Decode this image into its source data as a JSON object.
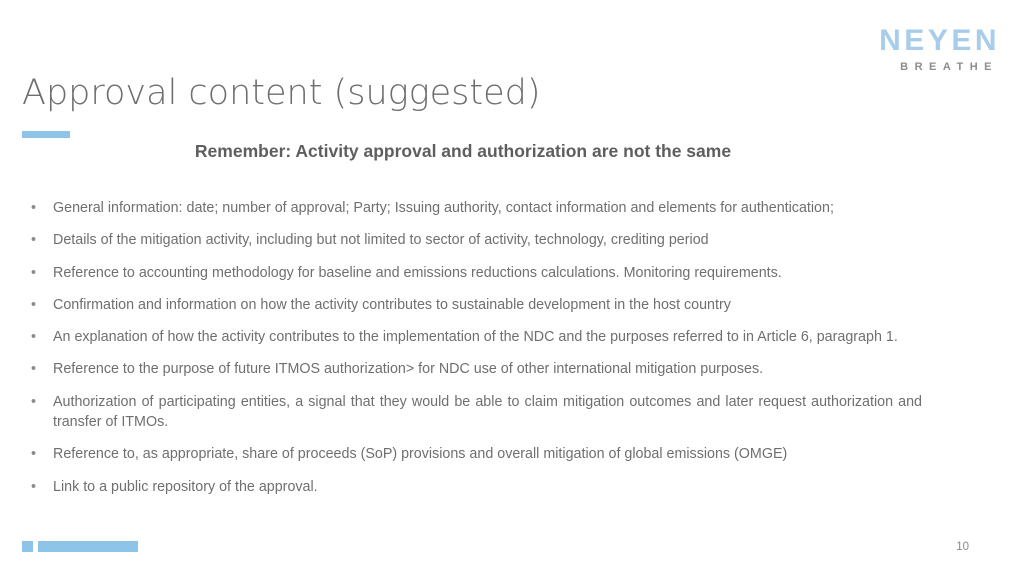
{
  "slide": {
    "title": "Approval content (suggested)",
    "subtitle": "Remember: Activity approval and authorization are not the same",
    "page_number": "10",
    "bullet_marker": "•",
    "accent_color": "#8ec4e8",
    "title_color": "#6e6e6e",
    "body_text_color": "#6f6f6f"
  },
  "logo": {
    "name": "NEYEN",
    "tagline": "BREATHE",
    "name_color": "#a8cdea",
    "tagline_color": "#8d8d8d"
  },
  "bullets": [
    {
      "text": "General information: date; number of approval; Party; Issuing authority, contact information and elements for authentication;"
    },
    {
      "text": "Details of the mitigation activity, including but not limited to sector of activity, technology, crediting period"
    },
    {
      "text": "Reference to accounting methodology for baseline and emissions reductions calculations. Monitoring requirements."
    },
    {
      "text": "Confirmation and information on how the activity contributes to sustainable development in the host country"
    },
    {
      "text": "An explanation of how the activity contributes to the implementation of the NDC and the purposes referred to in Article 6, paragraph 1."
    },
    {
      "text": "Reference to the purpose of future ITMOS authorization>  for NDC use of other international mitigation purposes."
    },
    {
      "text": "Authorization of participating entities, a signal that they would be able to claim mitigation outcomes and later request authorization and transfer of ITMOs."
    },
    {
      "text": "Reference to, as appropriate,  share of proceeds (SoP) provisions and overall mitigation of global emissions (OMGE)"
    },
    {
      "text": "Link to a public repository of the approval."
    }
  ]
}
